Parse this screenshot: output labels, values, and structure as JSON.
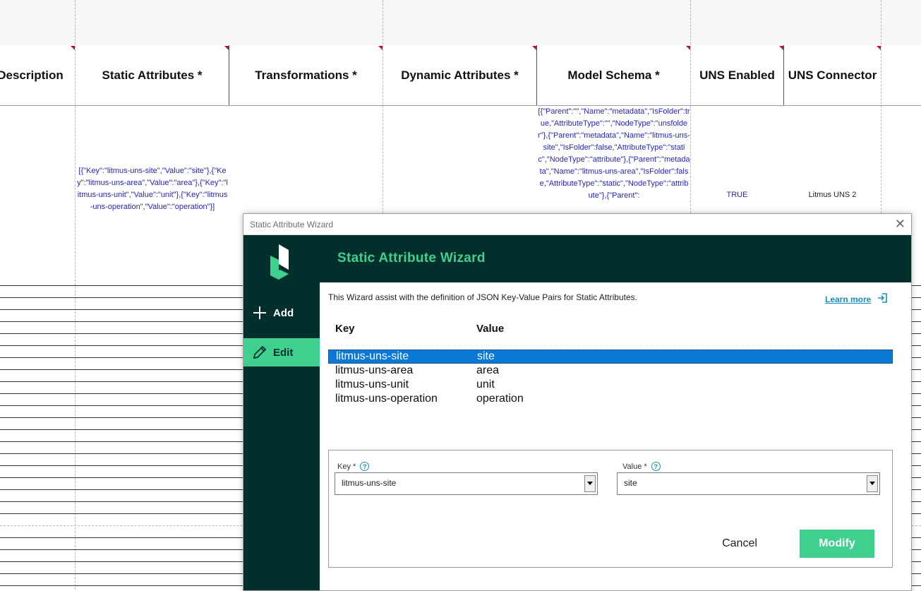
{
  "sheet": {
    "headers": [
      "Description",
      "Static Attributes *",
      "Transformations *",
      "Dynamic Attributes *",
      "Model Schema *",
      "UNS Enabled",
      "UNS Connector"
    ],
    "static_attributes_value": "[{\"Key\":\"litmus-uns-site\",\"Value\":\"site\"},{\"Key\":\"litmus-uns-area\",\"Value\":\"area\"},{\"Key\":\"litmus-uns-unit\",\"Value\":\"unit\"},{\"Key\":\"litmus-uns-operation\",\"Value\":\"operation\"}]",
    "model_schema_value": "[{\"Parent\":\"\",\"Name\":\"metadata\",\"IsFolder\":true,\"AttributeType\":\"\",\"NodeType\":\"unsfolder\"},{\"Parent\":\"metadata\",\"Name\":\"litmus-uns-site\",\"IsFolder\":false,\"AttributeType\":\"static\",\"NodeType\":\"attribute\"},{\"Parent\":\"metadata\",\"Name\":\"litmus-uns-area\",\"IsFolder\":false,\"AttributeType\":\"static\",\"NodeType\":\"attribute\"},{\"Parent\":",
    "uns_enabled_value": "TRUE",
    "uns_connector_value": "Litmus UNS 2"
  },
  "dialog": {
    "window_title": "Static Attribute Wizard",
    "banner_title": "Static Attribute Wizard",
    "nav": [
      {
        "label": "Add",
        "icon": "plus-icon"
      },
      {
        "label": "Edit",
        "icon": "pencil-icon"
      }
    ],
    "description": "This Wizard assist with the definition of JSON Key-Value Pairs for Static Attributes.",
    "learn_more": "Learn more",
    "columns": {
      "key": "Key",
      "value": "Value"
    },
    "rows": [
      {
        "key": "litmus-uns-site",
        "value": "site"
      },
      {
        "key": "litmus-uns-area",
        "value": "area"
      },
      {
        "key": "litmus-uns-unit",
        "value": "unit"
      },
      {
        "key": "litmus-uns-operation",
        "value": "operation"
      }
    ],
    "form": {
      "key_label": "Key *",
      "key_value": "litmus-uns-site",
      "value_label": "Value *",
      "value_value": "site",
      "cancel": "Cancel",
      "modify": "Modify"
    },
    "colors": {
      "dark": "#012f2c",
      "accent": "#3fcf8e",
      "selection": "#0a78d7",
      "link": "#1a8fb8"
    }
  }
}
